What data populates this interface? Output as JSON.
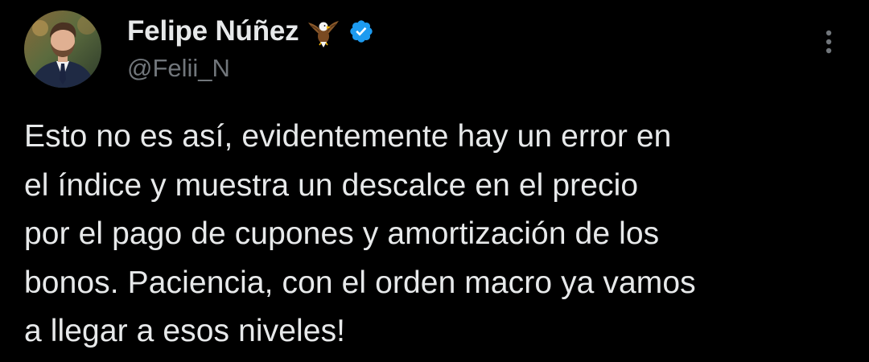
{
  "tweet": {
    "author": {
      "display_name": "Felipe Núñez",
      "name_emoji": "eagle-emoji",
      "verified": true,
      "handle": "@Felii_N"
    },
    "text": "Esto no es así, evidentemente hay un error en\nel índice y muestra un descalce en el precio\npor el pago de cupones y amortización de los\nbonos. Paciencia, con el orden macro ya vamos\na llegar a esos niveles!",
    "more_menu_icon": "more-vertical-icon"
  },
  "colors": {
    "background": "#000000",
    "primary_text": "#e7e9ea",
    "secondary_text": "#71767b",
    "verified_blue": "#1d9bf0"
  }
}
